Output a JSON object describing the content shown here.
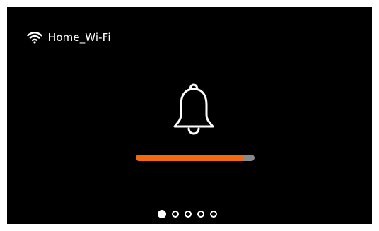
{
  "status_bar": {
    "wifi_icon": "wifi-icon",
    "network_name": "Home_Wi-Fi"
  },
  "main": {
    "icon": "bell-icon",
    "progress": {
      "fraction": 0.91,
      "fill_color": "#f26a10",
      "track_color": "#8a8a8a"
    }
  },
  "pagination": {
    "total_pages": 5,
    "current_page": 1
  },
  "colors": {
    "background": "#000000",
    "foreground": "#ffffff",
    "accent": "#f26a10"
  }
}
